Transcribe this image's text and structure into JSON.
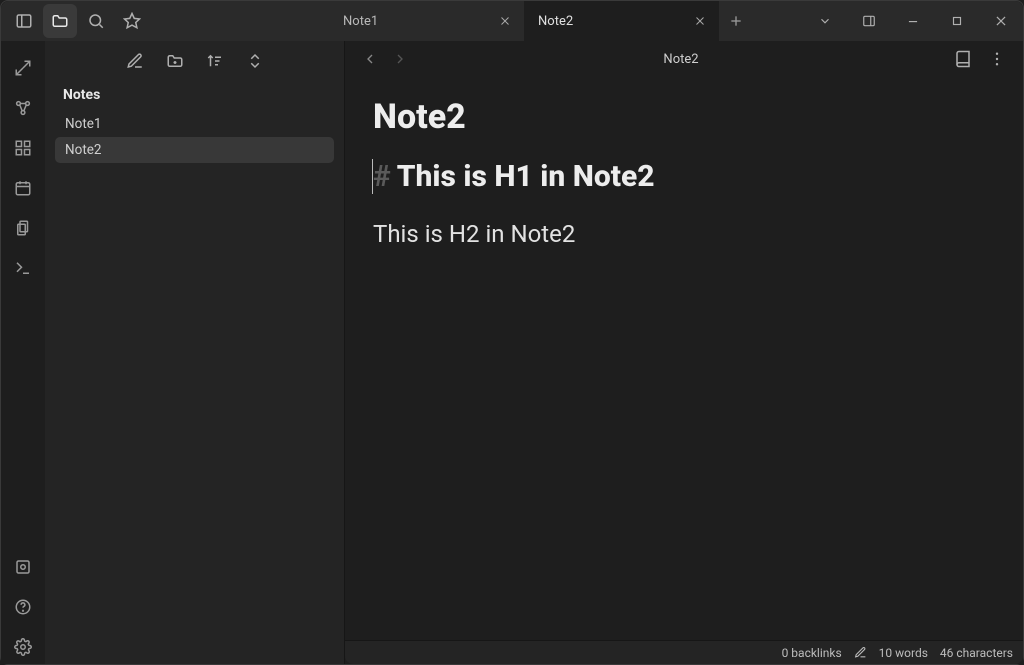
{
  "tabs": [
    {
      "label": "Note1",
      "active": false
    },
    {
      "label": "Note2",
      "active": true
    }
  ],
  "sidebar": {
    "vault_title": "Notes",
    "files": [
      {
        "name": "Note1",
        "active": false
      },
      {
        "name": "Note2",
        "active": true
      }
    ]
  },
  "editor": {
    "breadcrumb": "Note2",
    "title": "Note2",
    "h1_marker": "#",
    "h1_text": "This is H1 in Note2",
    "h2_text": "This is H2 in Note2"
  },
  "status": {
    "backlinks": "0 backlinks",
    "words": "10 words",
    "chars": "46 characters"
  }
}
